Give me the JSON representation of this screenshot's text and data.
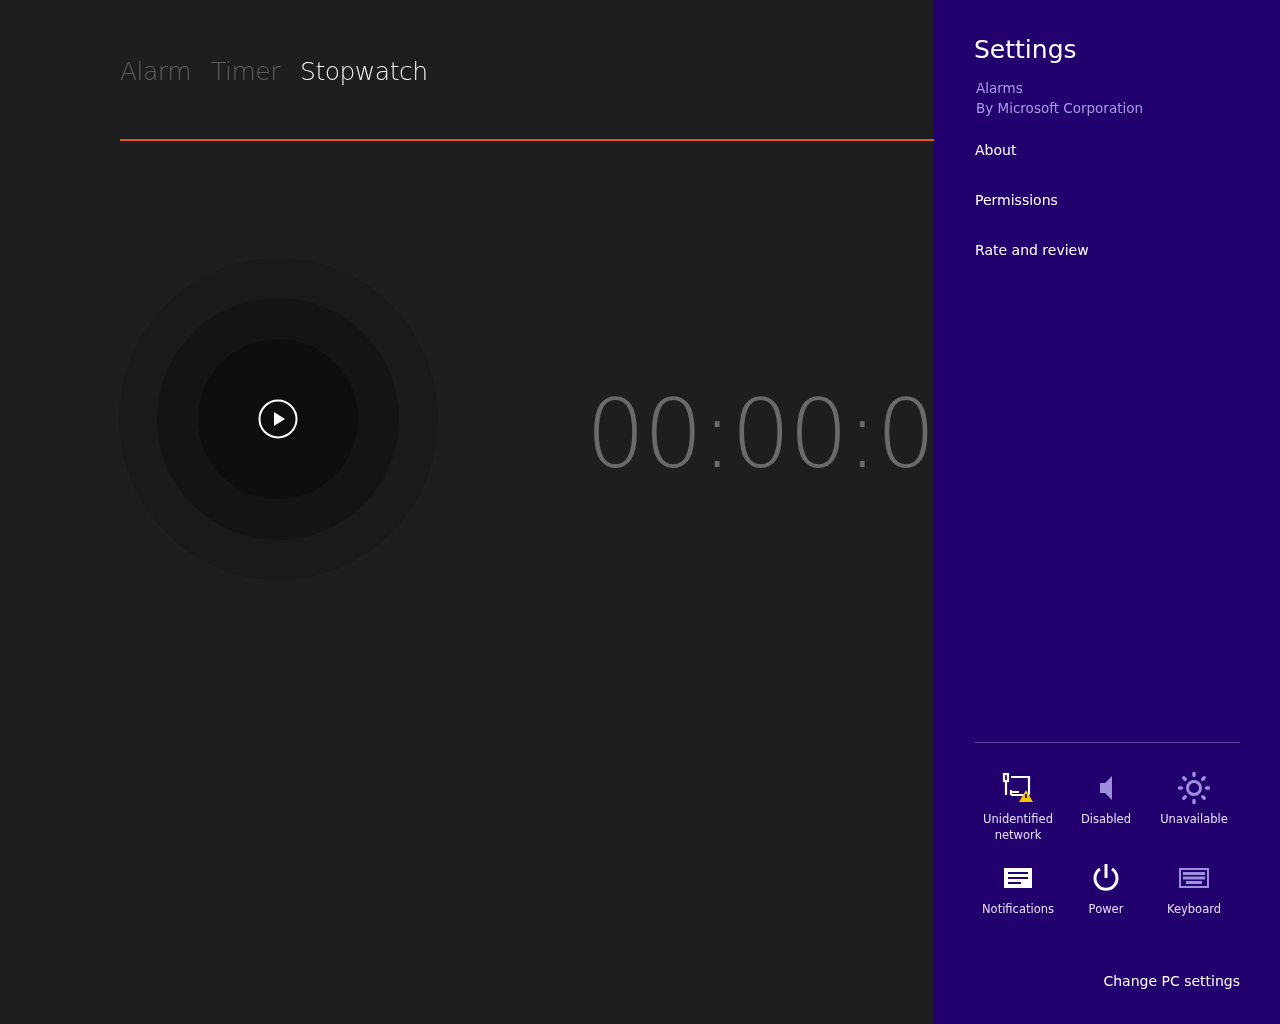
{
  "tabs": [
    {
      "label": "Alarm",
      "selected": false
    },
    {
      "label": "Timer",
      "selected": false
    },
    {
      "label": "Stopwatch",
      "selected": true
    }
  ],
  "stopwatch": {
    "time": "00:00:0"
  },
  "settings": {
    "title": "Settings",
    "app_name": "Alarms",
    "publisher": "By Microsoft Corporation",
    "items": [
      "About",
      "Permissions",
      "Rate and review"
    ],
    "quick_settings": [
      {
        "kind": "network",
        "label": "Unidentified network",
        "disabled": false
      },
      {
        "kind": "volume",
        "label": "Disabled",
        "disabled": true
      },
      {
        "kind": "brightness",
        "label": "Unavailable",
        "disabled": true
      },
      {
        "kind": "notifications",
        "label": "Notifications",
        "disabled": false
      },
      {
        "kind": "power",
        "label": "Power",
        "disabled": false
      },
      {
        "kind": "keyboard",
        "label": "Keyboard",
        "disabled": true
      }
    ],
    "footer_link": "Change PC settings"
  }
}
